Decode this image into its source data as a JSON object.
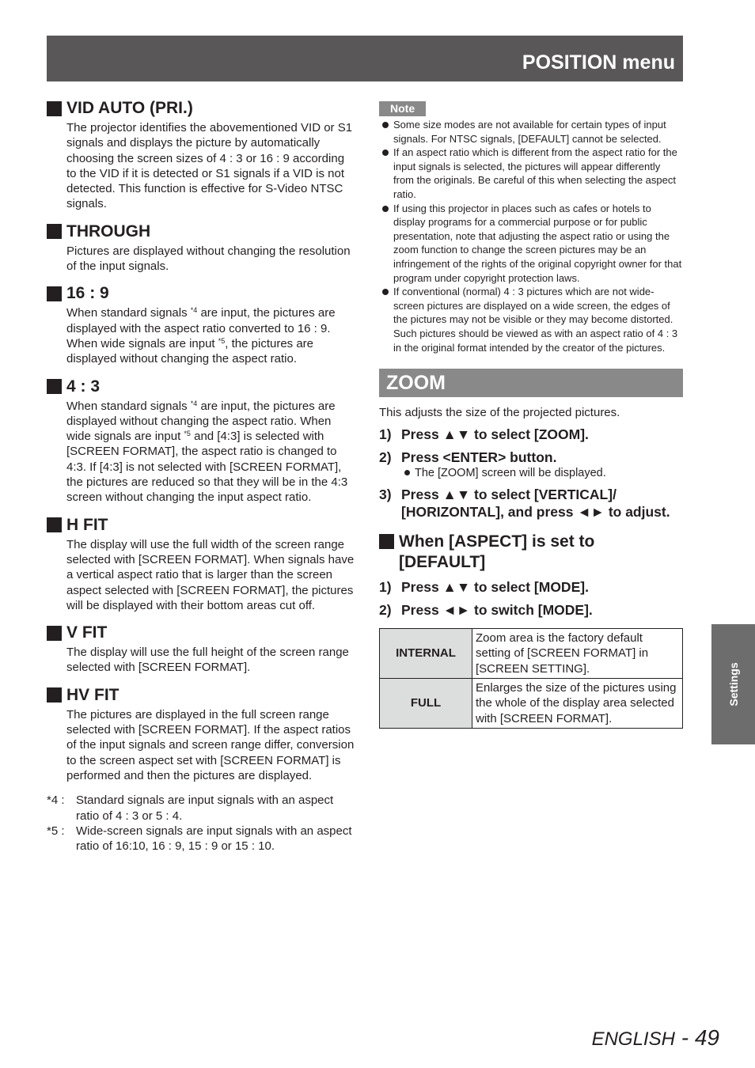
{
  "header": {
    "title": "POSITION menu"
  },
  "left_sections": [
    {
      "title": "VID AUTO (PRI.)",
      "text": "The projector identifies the abovementioned VID or S1 signals and displays the picture by automatically choosing the screen sizes of 4 : 3 or 16 : 9 according to the VID if it is detected or S1 signals if a VID is not detected. This function is effective for S-Video NTSC signals."
    },
    {
      "title": "THROUGH",
      "text": "Pictures are displayed without changing the resolution of the input signals."
    },
    {
      "title": "16 : 9",
      "text_a": "When standard signals ",
      "sup_a": "*4",
      "text_b": " are input, the pictures are displayed with the aspect ratio converted to 16 : 9. When wide signals are input ",
      "sup_b": "*5",
      "text_c": ", the pictures are displayed without changing the aspect ratio."
    },
    {
      "title": "4 : 3",
      "text_a": "When standard signals ",
      "sup_a": "*4",
      "text_b": " are input, the pictures are displayed without changing the aspect ratio. When wide signals are input ",
      "sup_b": "*5",
      "text_c": " and [4:3] is selected with [SCREEN FORMAT], the aspect ratio is changed to 4:3. If [4:3] is not selected with [SCREEN FORMAT], the pictures are reduced so that they will be in the 4:3 screen without changing the input aspect ratio."
    },
    {
      "title": "H FIT",
      "text": "The display will use the full width of the screen range selected with [SCREEN FORMAT]. When signals have a vertical aspect ratio that is larger than the screen aspect selected with [SCREEN FORMAT], the pictures will be displayed with their bottom areas cut off."
    },
    {
      "title": "V FIT",
      "text": "The display will use the full height of the screen range selected with [SCREEN FORMAT]."
    },
    {
      "title": "HV FIT",
      "text": "The pictures are displayed in the full screen range selected with [SCREEN FORMAT]. If the aspect ratios of the input signals and screen range differ, conversion to the screen aspect set with [SCREEN FORMAT] is performed and then the pictures are displayed."
    }
  ],
  "footnotes": [
    {
      "key": "*4 :",
      "text": "Standard signals are input signals with an aspect ratio of 4 : 3 or 5 : 4."
    },
    {
      "key": "*5 :",
      "text": "Wide-screen signals are input signals with an aspect ratio of 16:10, 16 : 9, 15 : 9 or 15 : 10."
    }
  ],
  "note": {
    "label": "Note",
    "items": [
      "Some size modes are not available for certain types of input signals. For NTSC signals, [DEFAULT] cannot be selected.",
      "If an aspect ratio which is different from the aspect ratio for the input signals is selected, the pictures will appear differently from the originals. Be careful of this when selecting the aspect ratio.",
      "If using this projector in places such as cafes or hotels to display programs for a commercial purpose or for public presentation, note that adjusting the aspect ratio or using the zoom function to change the screen pictures may be an infringement of the rights of the original copyright owner for that program under copyright protection laws.",
      "If conventional (normal) 4 : 3 pictures which are not wide-screen pictures are displayed on a wide screen, the edges of the pictures may not be visible or they may become distorted. Such pictures should be viewed as with an aspect ratio of 4 : 3 in the original format intended by the creator of the pictures."
    ]
  },
  "zoom": {
    "title": "ZOOM",
    "intro": "This adjusts the size of the projected pictures.",
    "steps": [
      {
        "num": "1)",
        "text": "Press ▲▼ to select [ZOOM]."
      },
      {
        "num": "2)",
        "text": "Press <ENTER> button.",
        "sub": "The [ZOOM] screen will be displayed."
      },
      {
        "num": "3)",
        "text": "Press ▲▼ to select [VERTICAL]/ [HORIZONTAL], and press ◄► to adjust."
      }
    ],
    "default_section": {
      "title": "When [ASPECT] is set to [DEFAULT]",
      "steps": [
        {
          "num": "1)",
          "text": "Press ▲▼ to select [MODE]."
        },
        {
          "num": "2)",
          "text": "Press ◄► to switch [MODE]."
        }
      ],
      "table": [
        {
          "key": "INTERNAL",
          "value": "Zoom area is the factory default setting of [SCREEN FORMAT] in [SCREEN SETTING]."
        },
        {
          "key": "FULL",
          "value": "Enlarges the size of the pictures using the whole of the display area selected with [SCREEN FORMAT]."
        }
      ]
    }
  },
  "side_tab": {
    "label": "Settings"
  },
  "footer": {
    "language": "ENGLISH",
    "separator": " - ",
    "page": "49"
  }
}
